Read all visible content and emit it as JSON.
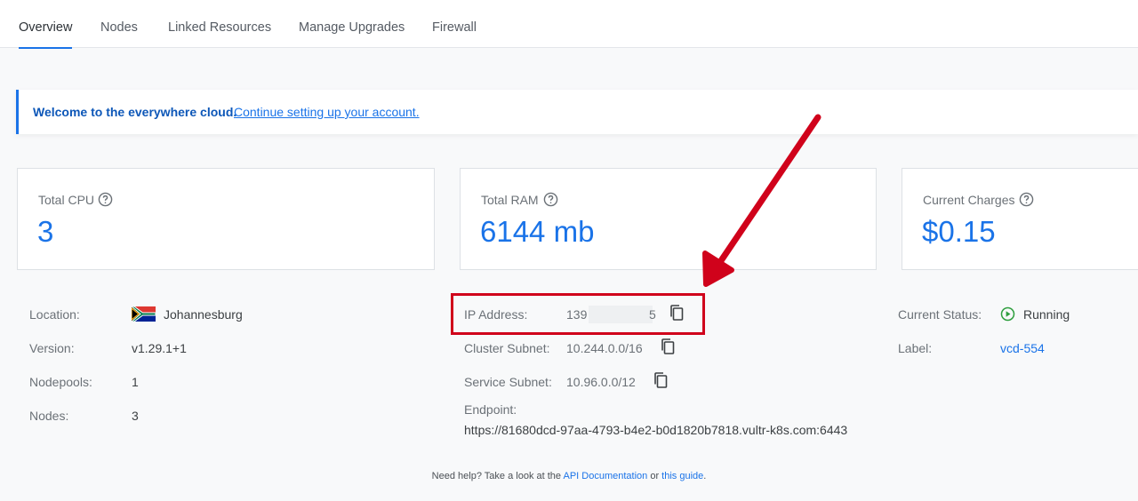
{
  "tabs": [
    {
      "label": "Overview",
      "active": true
    },
    {
      "label": "Nodes",
      "active": false
    },
    {
      "label": "Linked Resources",
      "active": false
    },
    {
      "label": "Manage Upgrades",
      "active": false
    },
    {
      "label": "Firewall",
      "active": false
    }
  ],
  "banner": {
    "text": "Welcome to the everywhere cloud.",
    "link": "Continue setting up your account."
  },
  "stats": [
    {
      "label": "Total CPU",
      "value": "3"
    },
    {
      "label": "Total RAM",
      "value": "6144 mb"
    },
    {
      "label": "Current Charges",
      "value": "$0.15"
    }
  ],
  "details_left": {
    "location_label": "Location:",
    "location_value": "Johannesburg",
    "version_label": "Version:",
    "version_value": "v1.29.1+1",
    "nodepools_label": "Nodepools:",
    "nodepools_value": "1",
    "nodes_label": "Nodes:",
    "nodes_value": "3"
  },
  "details_mid": {
    "ip_label": "IP Address:",
    "ip_value_start": "139",
    "ip_value_end": "5",
    "cluster_subnet_label": "Cluster Subnet:",
    "cluster_subnet_value": "10.244.0.0/16",
    "service_subnet_label": "Service Subnet:",
    "service_subnet_value": "10.96.0.0/12",
    "endpoint_label": "Endpoint:",
    "endpoint_value": "https://81680dcd-97aa-4793-b4e2-b0d1820b7818.vultr-k8s.com:6443"
  },
  "details_right": {
    "status_label": "Current Status:",
    "status_value": "Running",
    "label_label": "Label:",
    "label_value": "vcd-554"
  },
  "footer": {
    "prefix": "Need help? Take a look at the",
    "api_link": "API Documentation",
    "middle": "or",
    "guide_link": "this guide",
    "suffix": "."
  },
  "icons": {
    "help": "help-circle-icon",
    "copy": "copy-icon",
    "status": "play-circle-icon",
    "flag": "south-africa-flag-icon",
    "annotation": "red-arrow-annotation"
  },
  "colors": {
    "accent": "#1a73e8",
    "annotation": "#d0021b",
    "running": "#2e9e3e"
  }
}
